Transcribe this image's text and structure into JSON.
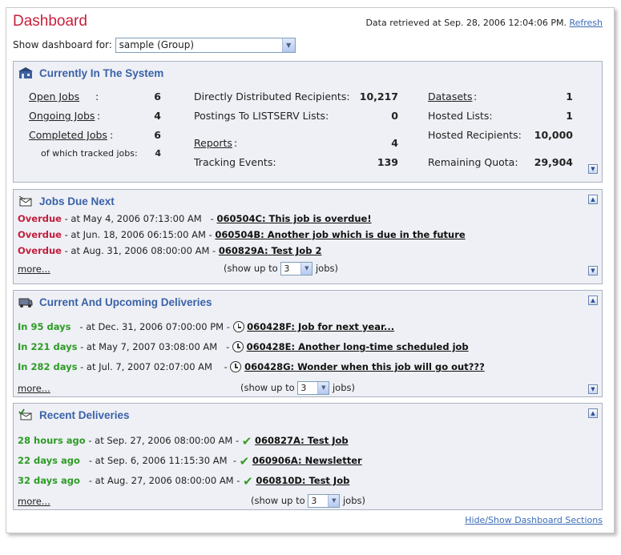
{
  "header": {
    "title": "Dashboard",
    "retrieved_text": "Data retrieved at Sep. 28, 2006 12:04:06 PM.",
    "refresh_label": "Refresh",
    "show_for_label": "Show dashboard for:",
    "show_for_value": "sample (Group)"
  },
  "system": {
    "title": "Currently In The System",
    "open_jobs_label": "Open Jobs",
    "open_jobs_value": "6",
    "ongoing_jobs_label": "Ongoing Jobs",
    "ongoing_jobs_value": "4",
    "completed_jobs_label": "Completed Jobs",
    "completed_jobs_value": "6",
    "tracked_label": "of which tracked jobs:",
    "tracked_value": "4",
    "direct_label": "Directly Distributed Recipients:",
    "direct_value": "10,217",
    "postings_label": "Postings To LISTSERV Lists:",
    "postings_value": "0",
    "reports_label": "Reports",
    "reports_value": "4",
    "tracking_label": "Tracking Events:",
    "tracking_value": "139",
    "datasets_label": "Datasets",
    "datasets_value": "1",
    "hosted_lists_label": "Hosted Lists:",
    "hosted_lists_value": "1",
    "hosted_recipients_label": "Hosted Recipients:",
    "hosted_recipients_value": "10,000",
    "quota_label": "Remaining Quota:",
    "quota_value": "29,904"
  },
  "jobs_due": {
    "title": "Jobs Due Next",
    "rows": [
      {
        "status": "Overdue",
        "date": " - at May 4, 2006 07:13:00 AM",
        "link": "060504C: This job is overdue!"
      },
      {
        "status": "Overdue",
        "date": " - at Jun. 18, 2006 06:15:00 AM",
        "link": "060504B: Another job which is due in the future"
      },
      {
        "status": "Overdue",
        "date": " - at Aug. 31, 2006 08:00:00 AM",
        "link": "060829A: Test Job 2"
      }
    ],
    "more": "more...",
    "show_up_to": "(show up to",
    "count": "3",
    "jobs": "jobs)"
  },
  "deliveries": {
    "title": "Current And Upcoming Deliveries",
    "rows": [
      {
        "status": "In 95 days",
        "date": " - at Dec. 31, 2006 07:00:00 PM",
        "link": "060428F: Job for next year..."
      },
      {
        "status": "In 221 days",
        "date": " - at May 7, 2007 03:08:00 AM",
        "link": "060428E: Another long-time scheduled job"
      },
      {
        "status": "In 282 days",
        "date": " - at Jul. 7, 2007 02:07:00 AM",
        "link": "060428G: Wonder when this job will go out???"
      }
    ],
    "more": "more...",
    "show_up_to": "(show up to",
    "count": "3",
    "jobs": "jobs)"
  },
  "recent": {
    "title": "Recent Deliveries",
    "rows": [
      {
        "status": "28 hours ago",
        "date": " - at Sep. 27, 2006 08:00:00 AM",
        "link": "060827A: Test Job"
      },
      {
        "status": "22 days ago",
        "date": " - at Sep. 6, 2006 11:15:30 AM",
        "link": "060906A: Newsletter"
      },
      {
        "status": "32 days ago",
        "date": " - at Aug. 27, 2006 08:00:00 AM",
        "link": "060810D: Test Job"
      }
    ],
    "more": "more...",
    "show_up_to": "(show up to",
    "count": "3",
    "jobs": "jobs)"
  },
  "footer": {
    "hide_show": "Hide/Show Dashboard Sections"
  },
  "colors": {
    "title_red": "#c8203c",
    "overdue_red": "#c51d3c",
    "upcoming_green": "#2e9b26",
    "section_blue": "#3a62a8",
    "panel_bg": "#eef0f5"
  }
}
